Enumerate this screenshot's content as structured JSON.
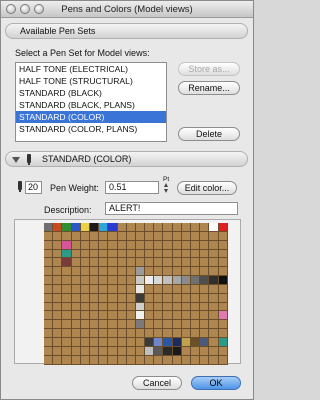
{
  "window": {
    "title": "Pens and Colors (Model views)"
  },
  "available_pen_sets": {
    "header": "Available Pen Sets",
    "prompt": "Select a Pen Set for Model views:",
    "items": [
      "HALF TONE (ELECTRICAL)",
      "HALF TONE (STRUCTURAL)",
      "STANDARD (BLACK)",
      "STANDARD (BLACK, PLANS)",
      "STANDARD (COLOR)",
      "STANDARD (COLOR, PLANS)"
    ],
    "selected_index": 4,
    "store_as_label": "Store as...",
    "rename_label": "Rename...",
    "delete_label": "Delete"
  },
  "pen_set_editor": {
    "header": "STANDARD (COLOR)",
    "pen_number": "20",
    "pen_weight_label": "Pen Weight:",
    "pen_weight_value": "0.51",
    "pen_weight_unit": "Pt",
    "edit_color_label": "Edit color...",
    "description_label": "Description:",
    "description_value": "ALERT!"
  },
  "palette": {
    "default_color": "#b08650",
    "special_cells": {
      "0-0": "#6f6f6f",
      "0-1": "#c84a1e",
      "0-2": "#2f8f2f",
      "0-3": "#2b56c8",
      "0-4": "#e8d24a",
      "0-5": "#1a1a1a",
      "0-6": "#2aa7d6",
      "0-7": "#2b3bd1",
      "0-18": "#ffffff",
      "0-19": "#e02020",
      "2-2": "#d8559b",
      "3-2": "#2a9b86",
      "4-2": "#7a3b3b",
      "5-10": "#9a9a9a",
      "6-10": "#c8c8c8",
      "6-11": "#eeeeee",
      "6-12": "#d8d8d8",
      "6-13": "#c0c0c0",
      "6-14": "#a8a8a8",
      "6-15": "#8c8c8c",
      "6-16": "#707070",
      "6-17": "#505050",
      "6-18": "#303030",
      "6-19": "#101010",
      "7-10": "#e8e8e8",
      "8-10": "#3a3a3a",
      "9-10": "#cfcfcf",
      "10-10": "#f0f0f0",
      "10-19": "#e07ab0",
      "11-10": "#7a7a7a",
      "13-11": "#3a3a3a",
      "13-12": "#6f86c8",
      "13-13": "#2b56a8",
      "13-14": "#1c2a5c",
      "13-15": "#bfa24a",
      "13-16": "#6f4e2a",
      "13-17": "#4a5a7a",
      "13-19": "#2a9b86",
      "14-11": "#bfbfbf",
      "14-12": "#5a5a5a",
      "14-13": "#2a2a2a",
      "14-14": "#1a1a1a"
    }
  },
  "footer": {
    "cancel_label": "Cancel",
    "ok_label": "OK"
  }
}
